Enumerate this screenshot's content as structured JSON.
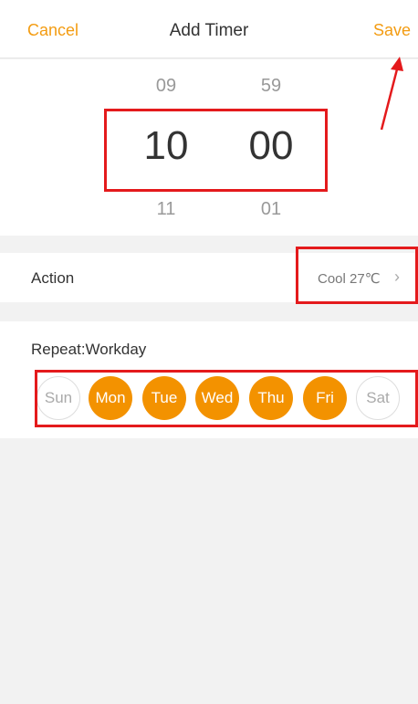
{
  "header": {
    "cancel_label": "Cancel",
    "title": "Add Timer",
    "save_label": "Save"
  },
  "picker": {
    "hours": {
      "prev": "09",
      "current": "10",
      "next": "11"
    },
    "minutes": {
      "prev": "59",
      "current": "00",
      "next": "01"
    }
  },
  "action": {
    "label": "Action",
    "value": "Cool 27℃",
    "chevron": "›"
  },
  "repeat": {
    "label": "Repeat:Workday",
    "days": [
      {
        "label": "Sun",
        "selected": false
      },
      {
        "label": "Mon",
        "selected": true
      },
      {
        "label": "Tue",
        "selected": true
      },
      {
        "label": "Wed",
        "selected": true
      },
      {
        "label": "Thu",
        "selected": true
      },
      {
        "label": "Fri",
        "selected": true
      },
      {
        "label": "Sat",
        "selected": false
      }
    ]
  },
  "colors": {
    "accent": "#f39c12",
    "day_selected": "#f39200",
    "annotation_red": "#e41a1c"
  }
}
